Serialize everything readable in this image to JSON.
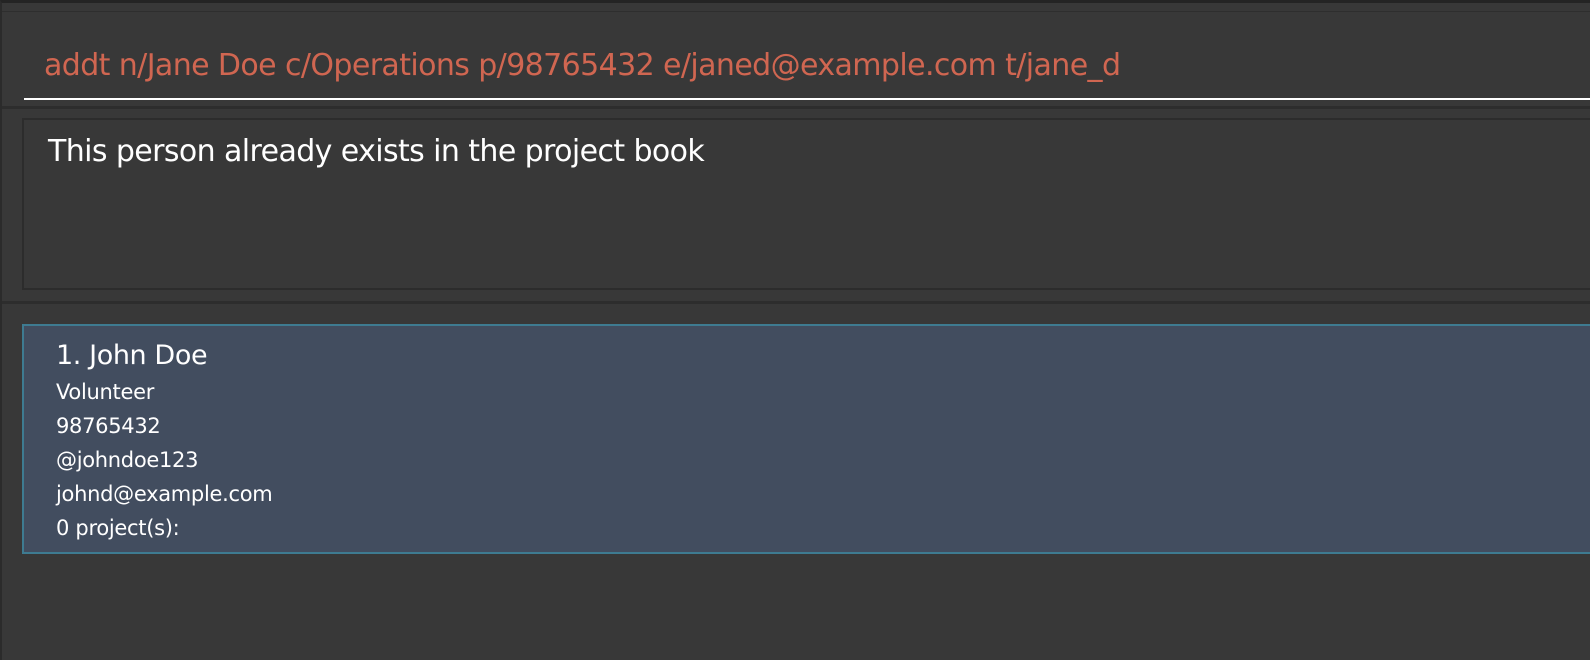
{
  "command_box": {
    "value": "addt n/Jane Doe c/Operations p/98765432 e/janed@example.com t/jane_d"
  },
  "result_display": {
    "message": "This person already exists in the project book"
  },
  "person_list": {
    "items": [
      {
        "index_name": "1. John Doe",
        "role": "Volunteer",
        "phone": "98765432",
        "telegram": "@johndoe123",
        "email": "johnd@example.com",
        "projects": "0 project(s):"
      }
    ]
  },
  "colors": {
    "background": "#383838",
    "command_text": "#d06651",
    "card_background": "#424d5f",
    "card_border": "#3e7b91",
    "text": "#ffffff"
  }
}
